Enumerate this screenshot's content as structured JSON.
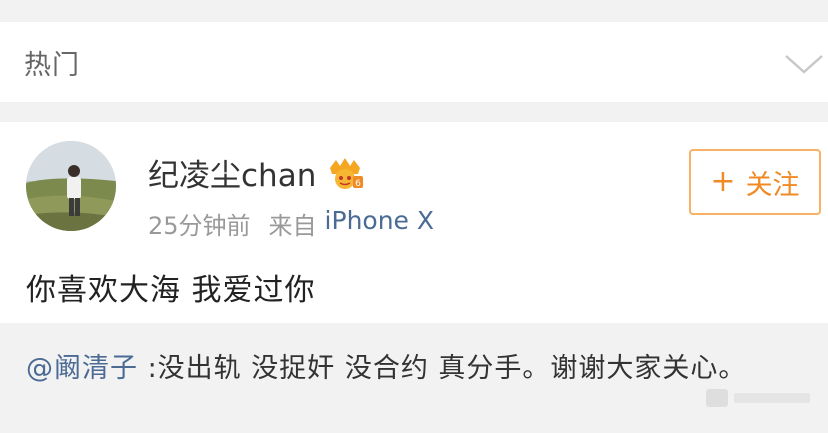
{
  "section": {
    "title": "热门",
    "icon": "chevron-down-icon"
  },
  "post": {
    "username": "纪凌尘chan",
    "badge_icon": "vip-crown-badge",
    "time": "25分钟前",
    "source_prefix": "来自",
    "device": "iPhone X",
    "follow_icon": "+",
    "follow_label": "关注",
    "text": "你喜欢大海 我爱过你"
  },
  "repost": {
    "mention": "@阚清子",
    "text": " :没出轨 没捉奸 没合约 真分手。谢谢大家关心。"
  },
  "colors": {
    "link": "#4b6b94",
    "follow_accent": "#f08a24",
    "follow_border": "#f8b266",
    "badge": "#f5a623"
  }
}
